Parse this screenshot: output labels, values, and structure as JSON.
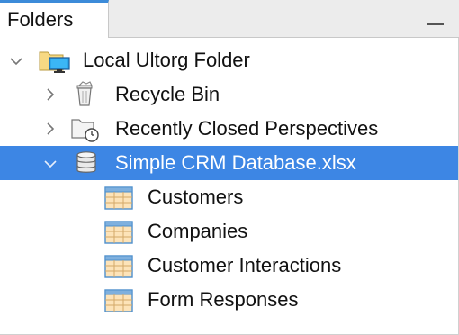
{
  "panel": {
    "tab_label": "Folders"
  },
  "tree": {
    "root": {
      "label": "Local Ultorg Folder",
      "expanded": true,
      "icon": "folder-monitor-icon"
    },
    "recycle": {
      "label": "Recycle Bin",
      "expanded": false,
      "icon": "recycle-bin-icon"
    },
    "recent": {
      "label": "Recently Closed Perspectives",
      "expanded": false,
      "icon": "folder-clock-icon"
    },
    "database": {
      "label": "Simple CRM Database.xlsx",
      "expanded": true,
      "selected": true,
      "icon": "database-icon"
    },
    "tables": [
      {
        "label": "Customers",
        "icon": "table-icon"
      },
      {
        "label": "Companies",
        "icon": "table-icon"
      },
      {
        "label": "Customer Interactions",
        "icon": "table-icon"
      },
      {
        "label": "Form Responses",
        "icon": "table-icon"
      }
    ]
  },
  "colors": {
    "selection": "#3d86e4",
    "tab_accent": "#3c8bd9"
  }
}
